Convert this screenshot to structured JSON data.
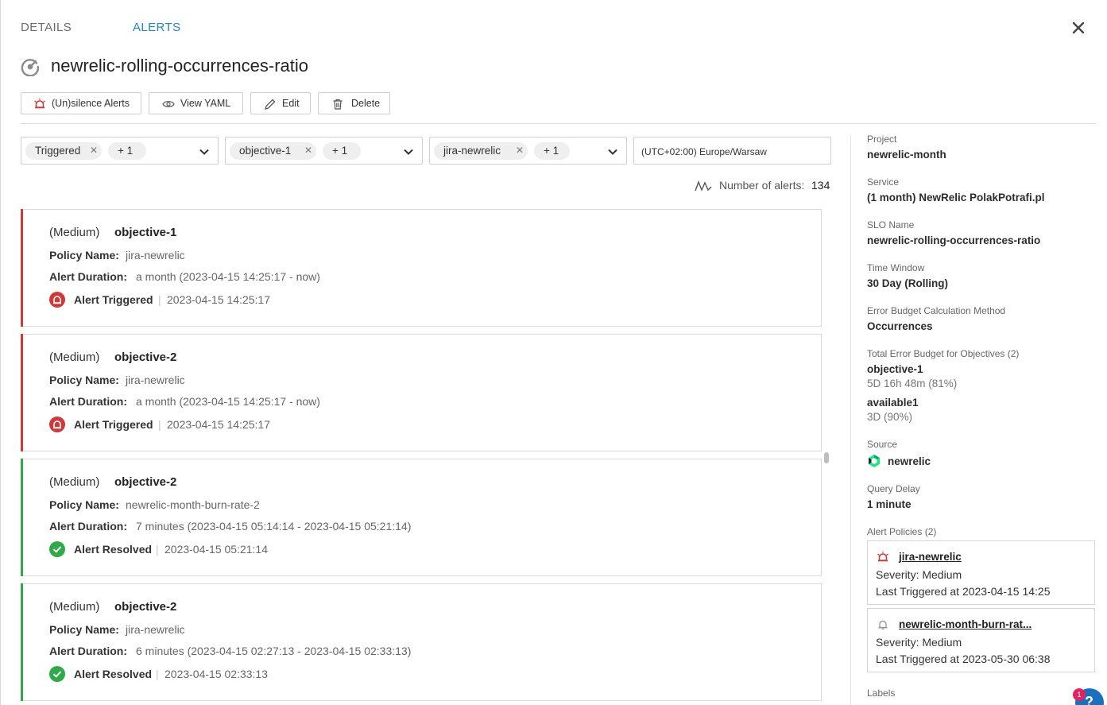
{
  "tabs": {
    "details": "DETAILS",
    "alerts": "ALERTS"
  },
  "title": "newrelic-rolling-occurrences-ratio",
  "toolbar": {
    "unsilence": "(Un)silence Alerts",
    "view_yaml": "View YAML",
    "edit": "Edit",
    "delete": "Delete"
  },
  "filters": [
    {
      "chip": "Triggered",
      "more": "+ 1"
    },
    {
      "chip": "objective-1",
      "more": "+ 1"
    },
    {
      "chip": "jira-newrelic",
      "more": "+ 1"
    }
  ],
  "timezone": "(UTC+02:00) Europe/Warsaw",
  "alert_count": {
    "label": "Number of alerts:",
    "value": "134"
  },
  "labels": {
    "policy_name": "Policy Name:",
    "alert_duration": "Alert Duration:"
  },
  "alerts": [
    {
      "severity": "(Medium)",
      "objective": "objective-1",
      "policy": "jira-newrelic",
      "duration": "a month (2023-04-15 14:25:17 - now)",
      "status": "Alert Triggered",
      "timestamp": "2023-04-15 14:25:17",
      "state": "triggered"
    },
    {
      "severity": "(Medium)",
      "objective": "objective-2",
      "policy": "jira-newrelic",
      "duration": "a month (2023-04-15 14:25:17 - now)",
      "status": "Alert Triggered",
      "timestamp": "2023-04-15 14:25:17",
      "state": "triggered"
    },
    {
      "severity": "(Medium)",
      "objective": "objective-2",
      "policy": "newrelic-month-burn-rate-2",
      "duration": "7 minutes (2023-04-15 05:14:14 - 2023-04-15 05:21:14)",
      "status": "Alert Resolved",
      "timestamp": "2023-04-15 05:21:14",
      "state": "resolved"
    },
    {
      "severity": "(Medium)",
      "objective": "objective-2",
      "policy": "jira-newrelic",
      "duration": "6 minutes (2023-04-15 02:27:13 - 2023-04-15 02:33:13)",
      "status": "Alert Resolved",
      "timestamp": "2023-04-15 02:33:13",
      "state": "resolved"
    }
  ],
  "side": {
    "project_label": "Project",
    "project": "newrelic-month",
    "service_label": "Service",
    "service": "(1 month) NewRelic PolakPotrafi.pl",
    "slo_label": "SLO Name",
    "slo": "newrelic-rolling-occurrences-ratio",
    "window_label": "Time Window",
    "window": "30 Day (Rolling)",
    "method_label": "Error Budget Calculation Method",
    "method": "Occurrences",
    "budget_label": "Total Error Budget for Objectives (2)",
    "objectives": [
      {
        "name": "objective-1",
        "value": "5D 16h 48m (81%)"
      },
      {
        "name": "available1",
        "value": "3D (90%)"
      }
    ],
    "source_label": "Source",
    "source": "newrelic",
    "delay_label": "Query Delay",
    "delay": "1 minute",
    "policies_label": "Alert Policies (2)",
    "policies": [
      {
        "name": "jira-newrelic",
        "severity": "Severity: Medium",
        "last": "Last Triggered at 2023-04-15 14:25",
        "icon": "alarm-icon"
      },
      {
        "name": "newrelic-month-burn-rat...",
        "severity": "Severity: Medium",
        "last": "Last Triggered at 2023-05-30 06:38",
        "icon": "bell-icon"
      }
    ],
    "labels_label": "Labels"
  },
  "help": {
    "badge": "1",
    "icon": "?"
  },
  "colors": {
    "accent": "#1a84c7",
    "triggered": "#d0393a",
    "resolved": "#2eaa48"
  }
}
